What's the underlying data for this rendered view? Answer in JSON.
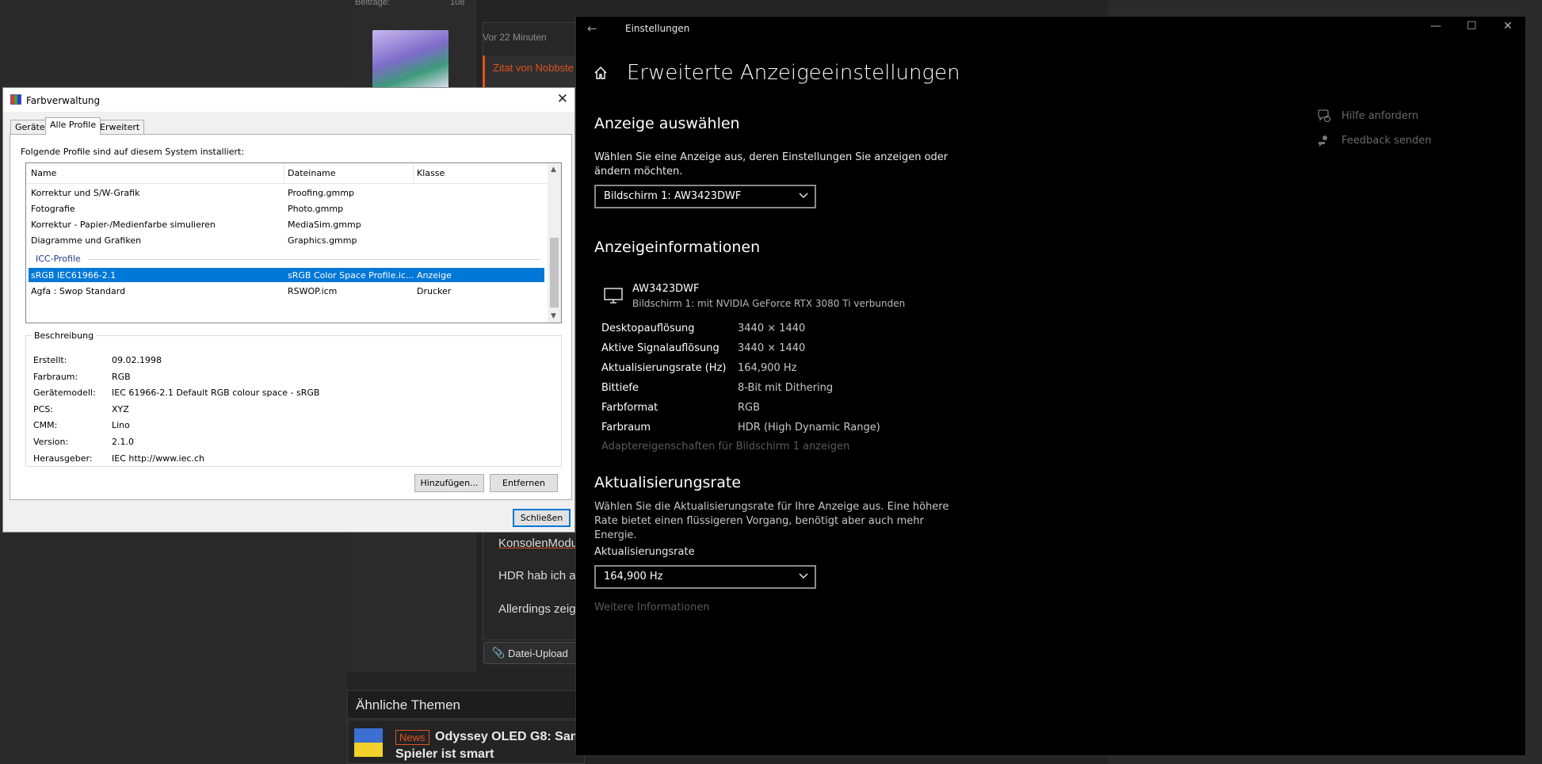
{
  "forum": {
    "stat_label": "Beiträge:",
    "stat_value": "108",
    "post_time": "Vor 22 Minuten",
    "quote_label": "Zitat von Nobbste",
    "body_lines": [
      "KonsolenModu",
      "HDR hab ich a",
      "Allerdings zeig"
    ],
    "upload_label": "Datei-Upload",
    "similar_heading": "Ähnliche Themen",
    "news_badge": "News",
    "thread_title_line1": "Odyssey OLED G8: Sam",
    "thread_title_line2": "Spieler ist smart"
  },
  "farbverwaltung": {
    "window_title": "Farbverwaltung",
    "tabs": [
      "Geräte",
      "Alle Profile",
      "Erweitert"
    ],
    "active_tab": "Alle Profile",
    "intro_text": "Folgende Profile sind auf diesem System installiert:",
    "columns": [
      "Name",
      "Dateiname",
      "Klasse"
    ],
    "rows": [
      {
        "name": "Korrektur und S/W-Grafik",
        "file": "Proofing.gmmp",
        "klass": ""
      },
      {
        "name": "Fotografie",
        "file": "Photo.gmmp",
        "klass": ""
      },
      {
        "name": "Korrektur - Papier-/Medienfarbe simulieren",
        "file": "MediaSim.gmmp",
        "klass": ""
      },
      {
        "name": "Diagramme und Grafiken",
        "file": "Graphics.gmmp",
        "klass": ""
      }
    ],
    "group_label": "ICC-Profile",
    "icc_rows": [
      {
        "name": "sRGB IEC61966-2.1",
        "file": "sRGB Color Space Profile.ic...",
        "klass": "Anzeige",
        "selected": true
      },
      {
        "name": "Agfa : Swop Standard",
        "file": "RSWOP.icm",
        "klass": "Drucker",
        "selected": false
      }
    ],
    "description_legend": "Beschreibung",
    "description": [
      {
        "key": "Erstellt:",
        "value": "09.02.1998"
      },
      {
        "key": "Farbraum:",
        "value": "RGB"
      },
      {
        "key": "Gerätemodell:",
        "value": "IEC 61966-2.1 Default RGB colour space - sRGB"
      },
      {
        "key": "PCS:",
        "value": "XYZ"
      },
      {
        "key": "CMM:",
        "value": "Lino"
      },
      {
        "key": "Version:",
        "value": "2.1.0"
      },
      {
        "key": "Herausgeber:",
        "value": "IEC http://www.iec.ch"
      }
    ],
    "add_button": "Hinzufügen...",
    "remove_button": "Entfernen",
    "close_button": "Schließen"
  },
  "settings": {
    "window_title": "Einstellungen",
    "page_title": "Erweiterte Anzeigeeinstellungen",
    "select_heading": "Anzeige auswählen",
    "select_desc": "Wählen Sie eine Anzeige aus, deren Einstellungen Sie anzeigen oder ändern möchten.",
    "display_dropdown": "Bildschirm 1: AW3423DWF",
    "info_heading": "Anzeigeinformationen",
    "monitor_name": "AW3423DWF",
    "monitor_sub": "Bildschirm 1: mit NVIDIA GeForce RTX 3080 Ti verbunden",
    "info_rows": [
      {
        "key": "Desktopauflösung",
        "value": "3440 × 1440"
      },
      {
        "key": "Aktive Signalauflösung",
        "value": "3440 × 1440"
      },
      {
        "key": "Aktualisierungsrate (Hz)",
        "value": "164,900 Hz"
      },
      {
        "key": "Bittiefe",
        "value": "8-Bit mit Dithering"
      },
      {
        "key": "Farbformat",
        "value": "RGB"
      },
      {
        "key": "Farbraum",
        "value": "HDR (High Dynamic Range)"
      }
    ],
    "adapter_link": "Adaptereigenschaften für Bildschirm 1 anzeigen",
    "refresh_heading": "Aktualisierungsrate",
    "refresh_desc": "Wählen Sie die Aktualisierungsrate für Ihre Anzeige aus. Eine höhere Rate bietet einen flüssigeren Vorgang, benötigt aber auch mehr Energie.",
    "refresh_label": "Aktualisierungsrate",
    "refresh_dropdown": "164,900 Hz",
    "more_info": "Weitere Informationen",
    "help_link": "Hilfe anfordern",
    "feedback_link": "Feedback senden"
  },
  "colors": {
    "selection_blue": "#0078d7",
    "forum_accent": "#e0531f"
  }
}
